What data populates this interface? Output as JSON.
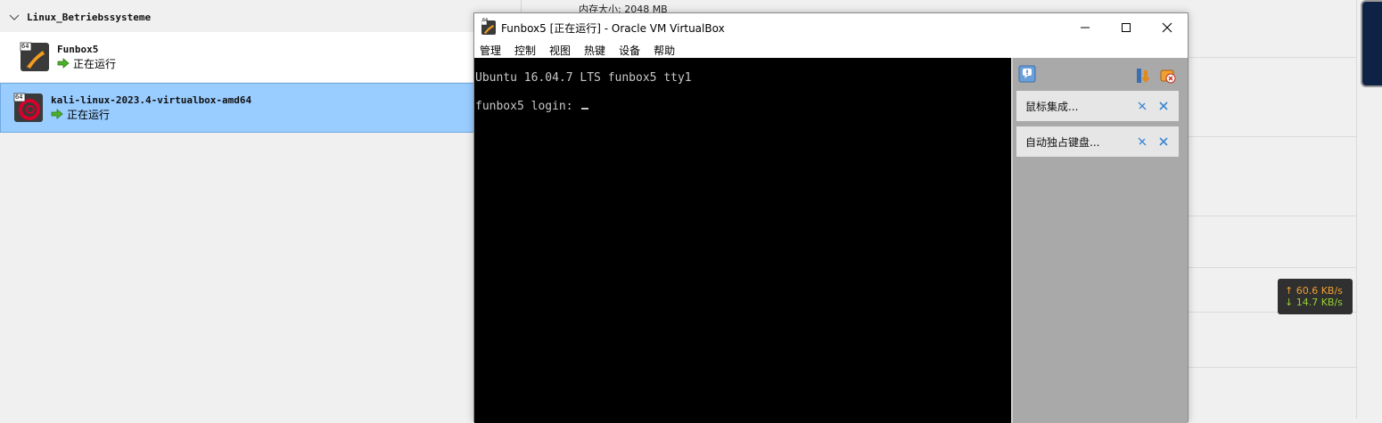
{
  "manager": {
    "group_name": "Linux_Betriebssysteme",
    "memory_label": "内存大小:   2048 MB",
    "vms": [
      {
        "name": "Funbox5",
        "os_badge": "64",
        "state": "正在运行"
      },
      {
        "name": "kali-linux-2023.4-virtualbox-amd64",
        "os_badge": "64",
        "state": "正在运行"
      }
    ]
  },
  "vm_window": {
    "title": "Funbox5 [正在运行] - Oracle VM VirtualBox",
    "app_badge": "64",
    "menu": [
      "管理",
      "控制",
      "视图",
      "热键",
      "设备",
      "帮助"
    ],
    "console": {
      "line1": "Ubuntu 16.04.7 LTS funbox5 tty1",
      "line2": "funbox5 login: "
    },
    "notifications": [
      {
        "text": "鼠标集成..."
      },
      {
        "text": "自动独占键盘..."
      }
    ]
  },
  "net_widget": {
    "upload": "↑ 60.6 KB/s",
    "download": "↓ 14.7 KB/s"
  },
  "colors": {
    "selection": "#99ccff",
    "panel": "#a9a9a9",
    "upload": "#f0a030",
    "download": "#9ad030"
  }
}
